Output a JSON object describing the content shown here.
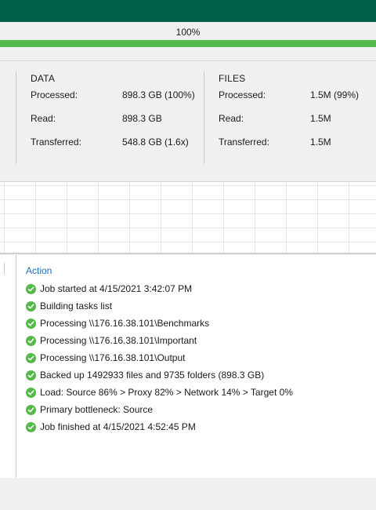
{
  "progress": {
    "label": "100%",
    "fraction": 1.0
  },
  "stats": {
    "data": {
      "heading": "DATA",
      "rows": [
        {
          "label": "Processed:",
          "value": "898.3 GB (100%)"
        },
        {
          "label": "Read:",
          "value": "898.3 GB"
        },
        {
          "label": "Transferred:",
          "value": "548.8 GB (1.6x)"
        }
      ]
    },
    "files": {
      "heading": "FILES",
      "rows": [
        {
          "label": "Processed:",
          "value": "1.5M (99%)"
        },
        {
          "label": "Read:",
          "value": "1.5M"
        },
        {
          "label": "Transferred:",
          "value": "1.5M"
        }
      ]
    }
  },
  "log": {
    "header": "Action",
    "items": [
      {
        "icon": "success-check-icon",
        "text": "Job started at 4/15/2021 3:42:07 PM"
      },
      {
        "icon": "success-check-icon",
        "text": "Building tasks list"
      },
      {
        "icon": "success-check-icon",
        "text": "Processing \\\\176.16.38.101\\Benchmarks"
      },
      {
        "icon": "success-check-icon",
        "text": "Processing \\\\176.16.38.101\\Important"
      },
      {
        "icon": "success-check-icon",
        "text": "Processing \\\\176.16.38.101\\Output"
      },
      {
        "icon": "success-check-icon",
        "text": "Backed up 1492933 files and 9735 folders (898.3 GB)"
      },
      {
        "icon": "success-check-icon",
        "text": "Load: Source 86% > Proxy 82% > Network 14% > Target 0%"
      },
      {
        "icon": "success-check-icon",
        "text": "Primary bottleneck: Source"
      },
      {
        "icon": "success-check-icon",
        "text": "Job finished at 4/15/2021 4:52:45 PM"
      }
    ]
  },
  "colors": {
    "titlebar": "#005f4b",
    "progress_fill": "#54b948",
    "success": "#54b948",
    "link_header": "#1f6fb0"
  }
}
